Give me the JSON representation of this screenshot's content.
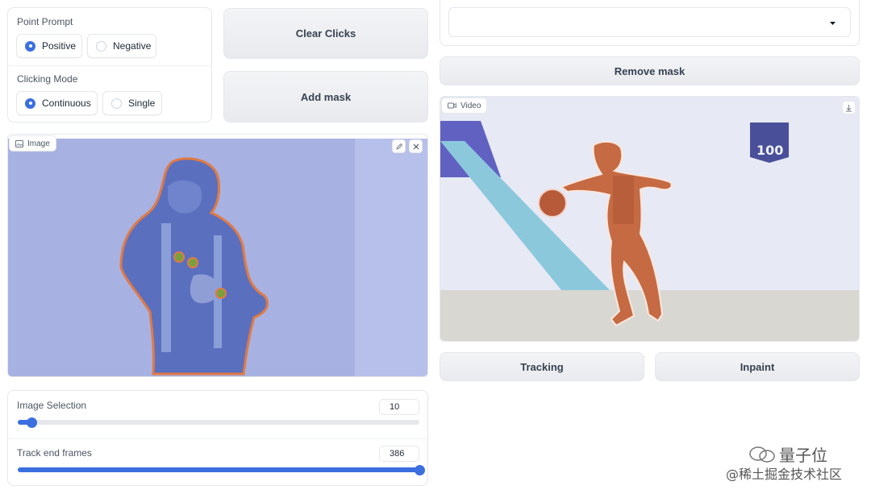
{
  "point_prompt": {
    "label": "Point Prompt",
    "options": [
      "Positive",
      "Negative"
    ],
    "selected": "Positive"
  },
  "clicking_mode": {
    "label": "Clicking Mode",
    "options": [
      "Continuous",
      "Single"
    ],
    "selected": "Continuous"
  },
  "buttons": {
    "clear_clicks": "Clear Clicks",
    "add_mask": "Add mask",
    "remove_mask": "Remove mask",
    "tracking": "Tracking",
    "inpaint": "Inpaint"
  },
  "dropdown": {
    "value": ""
  },
  "image_panel": {
    "label": "Image"
  },
  "video_panel": {
    "label": "Video",
    "board_text": "100"
  },
  "sliders": {
    "image_selection": {
      "label": "Image Selection",
      "value": "10",
      "fraction": 0.035
    },
    "track_end_frames": {
      "label": "Track end frames",
      "value": "386",
      "fraction": 1.0
    }
  },
  "watermark": {
    "top": "量子位",
    "bottom": "@稀土掘金技术社区"
  },
  "colors": {
    "accent": "#3b6fe0",
    "mask_blue": "#5b78c6",
    "mask_orange": "#c9693e",
    "click_point": "#7aa03d"
  }
}
